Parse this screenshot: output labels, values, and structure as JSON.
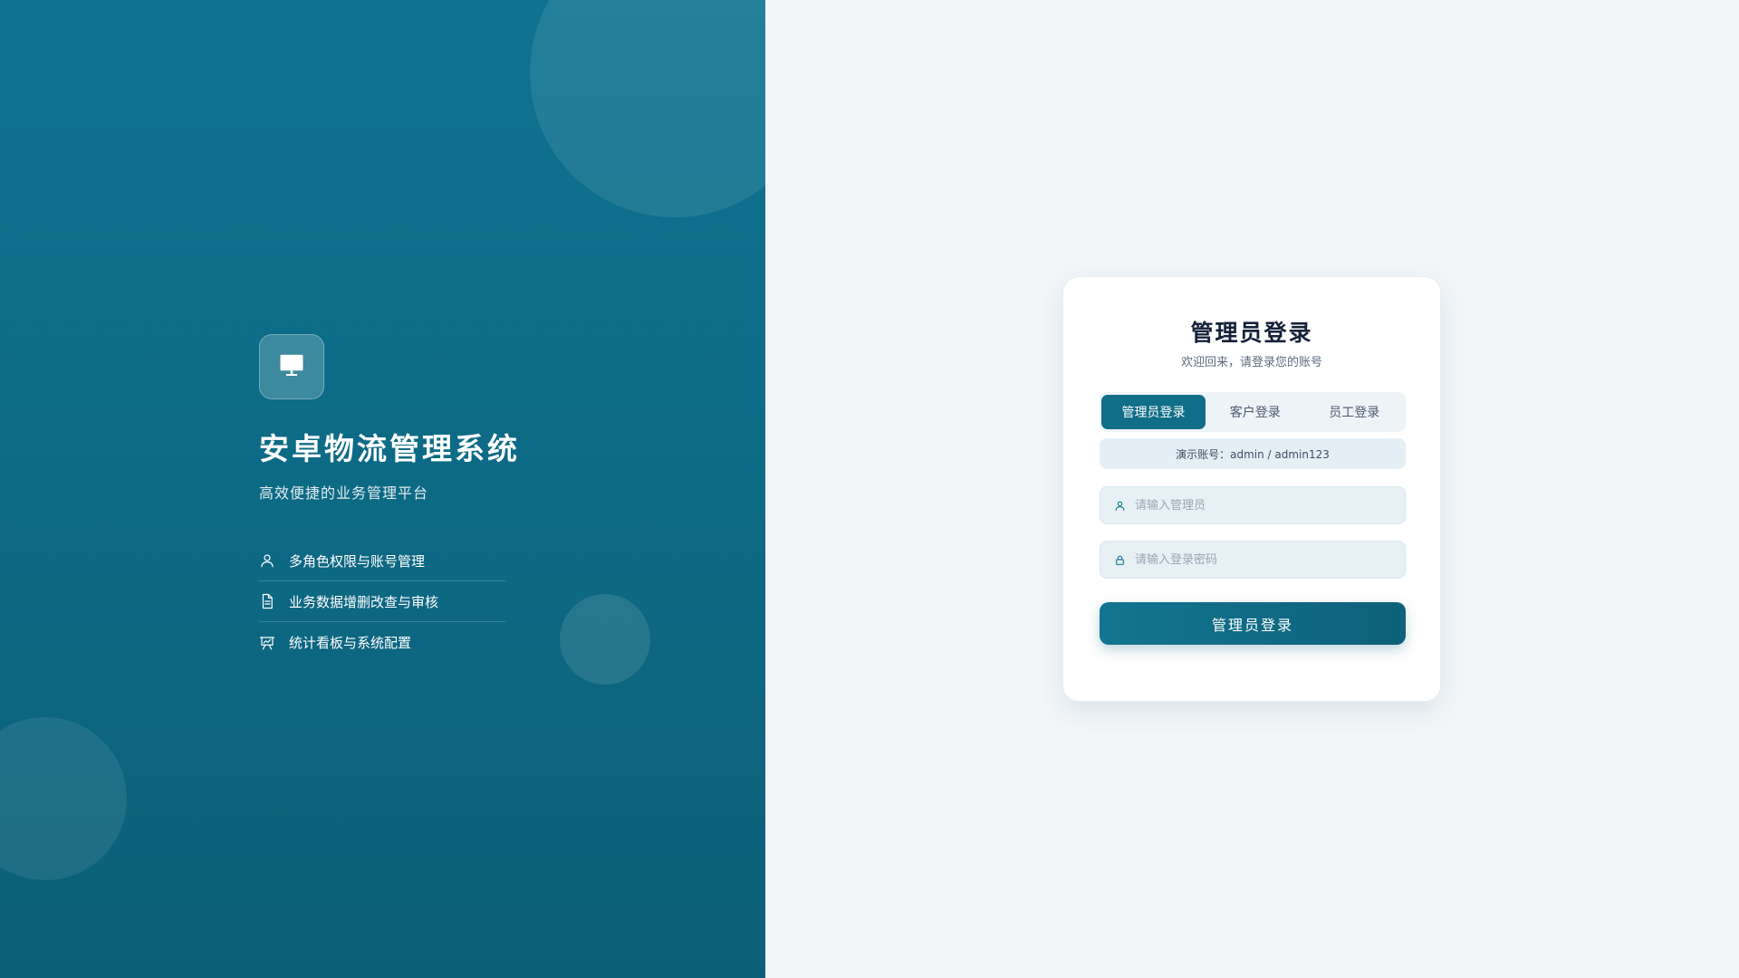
{
  "hero": {
    "title": "安卓物流管理系统",
    "subtitle": "高效便捷的业务管理平台",
    "logo_icon": "monitor-icon",
    "features": [
      {
        "icon": "user-icon",
        "label": "多角色权限与账号管理"
      },
      {
        "icon": "document-icon",
        "label": "业务数据增删改查与审核"
      },
      {
        "icon": "presentation-chart-icon",
        "label": "统计看板与系统配置"
      }
    ]
  },
  "login": {
    "title": "管理员登录",
    "subtitle": "欢迎回来，请登录您的账号",
    "tabs": [
      {
        "label": "管理员登录",
        "active": true
      },
      {
        "label": "客户登录",
        "active": false
      },
      {
        "label": "员工登录",
        "active": false
      }
    ],
    "demo_account": "演示账号：admin / admin123",
    "username": {
      "placeholder": "请输入管理员",
      "value": ""
    },
    "password": {
      "placeholder": "请输入登录密码",
      "value": ""
    },
    "submit_label": "管理员登录"
  },
  "colors": {
    "primary": "#106e89",
    "hero_bg": "#0d6a85",
    "page_bg": "#f2f6f9",
    "title_text": "#16223a"
  }
}
